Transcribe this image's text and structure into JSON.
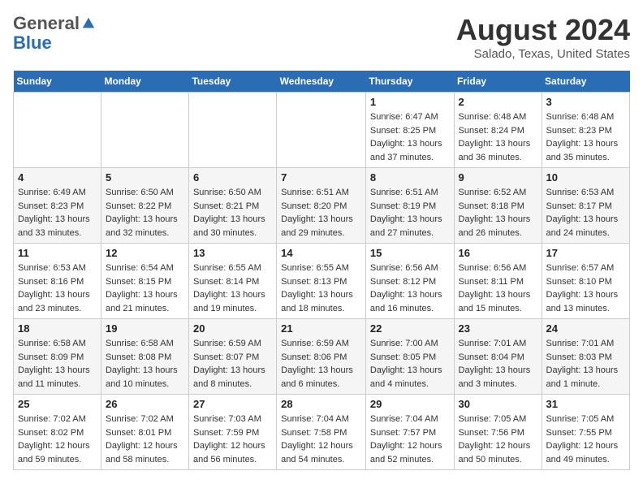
{
  "header": {
    "logo_general": "General",
    "logo_blue": "Blue",
    "month_year": "August 2024",
    "location": "Salado, Texas, United States"
  },
  "weekdays": [
    "Sunday",
    "Monday",
    "Tuesday",
    "Wednesday",
    "Thursday",
    "Friday",
    "Saturday"
  ],
  "weeks": [
    [
      {
        "day": "",
        "sunrise": "",
        "sunset": "",
        "daylight": ""
      },
      {
        "day": "",
        "sunrise": "",
        "sunset": "",
        "daylight": ""
      },
      {
        "day": "",
        "sunrise": "",
        "sunset": "",
        "daylight": ""
      },
      {
        "day": "",
        "sunrise": "",
        "sunset": "",
        "daylight": ""
      },
      {
        "day": "1",
        "sunrise": "Sunrise: 6:47 AM",
        "sunset": "Sunset: 8:25 PM",
        "daylight": "Daylight: 13 hours and 37 minutes."
      },
      {
        "day": "2",
        "sunrise": "Sunrise: 6:48 AM",
        "sunset": "Sunset: 8:24 PM",
        "daylight": "Daylight: 13 hours and 36 minutes."
      },
      {
        "day": "3",
        "sunrise": "Sunrise: 6:48 AM",
        "sunset": "Sunset: 8:23 PM",
        "daylight": "Daylight: 13 hours and 35 minutes."
      }
    ],
    [
      {
        "day": "4",
        "sunrise": "Sunrise: 6:49 AM",
        "sunset": "Sunset: 8:23 PM",
        "daylight": "Daylight: 13 hours and 33 minutes."
      },
      {
        "day": "5",
        "sunrise": "Sunrise: 6:50 AM",
        "sunset": "Sunset: 8:22 PM",
        "daylight": "Daylight: 13 hours and 32 minutes."
      },
      {
        "day": "6",
        "sunrise": "Sunrise: 6:50 AM",
        "sunset": "Sunset: 8:21 PM",
        "daylight": "Daylight: 13 hours and 30 minutes."
      },
      {
        "day": "7",
        "sunrise": "Sunrise: 6:51 AM",
        "sunset": "Sunset: 8:20 PM",
        "daylight": "Daylight: 13 hours and 29 minutes."
      },
      {
        "day": "8",
        "sunrise": "Sunrise: 6:51 AM",
        "sunset": "Sunset: 8:19 PM",
        "daylight": "Daylight: 13 hours and 27 minutes."
      },
      {
        "day": "9",
        "sunrise": "Sunrise: 6:52 AM",
        "sunset": "Sunset: 8:18 PM",
        "daylight": "Daylight: 13 hours and 26 minutes."
      },
      {
        "day": "10",
        "sunrise": "Sunrise: 6:53 AM",
        "sunset": "Sunset: 8:17 PM",
        "daylight": "Daylight: 13 hours and 24 minutes."
      }
    ],
    [
      {
        "day": "11",
        "sunrise": "Sunrise: 6:53 AM",
        "sunset": "Sunset: 8:16 PM",
        "daylight": "Daylight: 13 hours and 23 minutes."
      },
      {
        "day": "12",
        "sunrise": "Sunrise: 6:54 AM",
        "sunset": "Sunset: 8:15 PM",
        "daylight": "Daylight: 13 hours and 21 minutes."
      },
      {
        "day": "13",
        "sunrise": "Sunrise: 6:55 AM",
        "sunset": "Sunset: 8:14 PM",
        "daylight": "Daylight: 13 hours and 19 minutes."
      },
      {
        "day": "14",
        "sunrise": "Sunrise: 6:55 AM",
        "sunset": "Sunset: 8:13 PM",
        "daylight": "Daylight: 13 hours and 18 minutes."
      },
      {
        "day": "15",
        "sunrise": "Sunrise: 6:56 AM",
        "sunset": "Sunset: 8:12 PM",
        "daylight": "Daylight: 13 hours and 16 minutes."
      },
      {
        "day": "16",
        "sunrise": "Sunrise: 6:56 AM",
        "sunset": "Sunset: 8:11 PM",
        "daylight": "Daylight: 13 hours and 15 minutes."
      },
      {
        "day": "17",
        "sunrise": "Sunrise: 6:57 AM",
        "sunset": "Sunset: 8:10 PM",
        "daylight": "Daylight: 13 hours and 13 minutes."
      }
    ],
    [
      {
        "day": "18",
        "sunrise": "Sunrise: 6:58 AM",
        "sunset": "Sunset: 8:09 PM",
        "daylight": "Daylight: 13 hours and 11 minutes."
      },
      {
        "day": "19",
        "sunrise": "Sunrise: 6:58 AM",
        "sunset": "Sunset: 8:08 PM",
        "daylight": "Daylight: 13 hours and 10 minutes."
      },
      {
        "day": "20",
        "sunrise": "Sunrise: 6:59 AM",
        "sunset": "Sunset: 8:07 PM",
        "daylight": "Daylight: 13 hours and 8 minutes."
      },
      {
        "day": "21",
        "sunrise": "Sunrise: 6:59 AM",
        "sunset": "Sunset: 8:06 PM",
        "daylight": "Daylight: 13 hours and 6 minutes."
      },
      {
        "day": "22",
        "sunrise": "Sunrise: 7:00 AM",
        "sunset": "Sunset: 8:05 PM",
        "daylight": "Daylight: 13 hours and 4 minutes."
      },
      {
        "day": "23",
        "sunrise": "Sunrise: 7:01 AM",
        "sunset": "Sunset: 8:04 PM",
        "daylight": "Daylight: 13 hours and 3 minutes."
      },
      {
        "day": "24",
        "sunrise": "Sunrise: 7:01 AM",
        "sunset": "Sunset: 8:03 PM",
        "daylight": "Daylight: 13 hours and 1 minute."
      }
    ],
    [
      {
        "day": "25",
        "sunrise": "Sunrise: 7:02 AM",
        "sunset": "Sunset: 8:02 PM",
        "daylight": "Daylight: 12 hours and 59 minutes."
      },
      {
        "day": "26",
        "sunrise": "Sunrise: 7:02 AM",
        "sunset": "Sunset: 8:01 PM",
        "daylight": "Daylight: 12 hours and 58 minutes."
      },
      {
        "day": "27",
        "sunrise": "Sunrise: 7:03 AM",
        "sunset": "Sunset: 7:59 PM",
        "daylight": "Daylight: 12 hours and 56 minutes."
      },
      {
        "day": "28",
        "sunrise": "Sunrise: 7:04 AM",
        "sunset": "Sunset: 7:58 PM",
        "daylight": "Daylight: 12 hours and 54 minutes."
      },
      {
        "day": "29",
        "sunrise": "Sunrise: 7:04 AM",
        "sunset": "Sunset: 7:57 PM",
        "daylight": "Daylight: 12 hours and 52 minutes."
      },
      {
        "day": "30",
        "sunrise": "Sunrise: 7:05 AM",
        "sunset": "Sunset: 7:56 PM",
        "daylight": "Daylight: 12 hours and 50 minutes."
      },
      {
        "day": "31",
        "sunrise": "Sunrise: 7:05 AM",
        "sunset": "Sunset: 7:55 PM",
        "daylight": "Daylight: 12 hours and 49 minutes."
      }
    ]
  ]
}
